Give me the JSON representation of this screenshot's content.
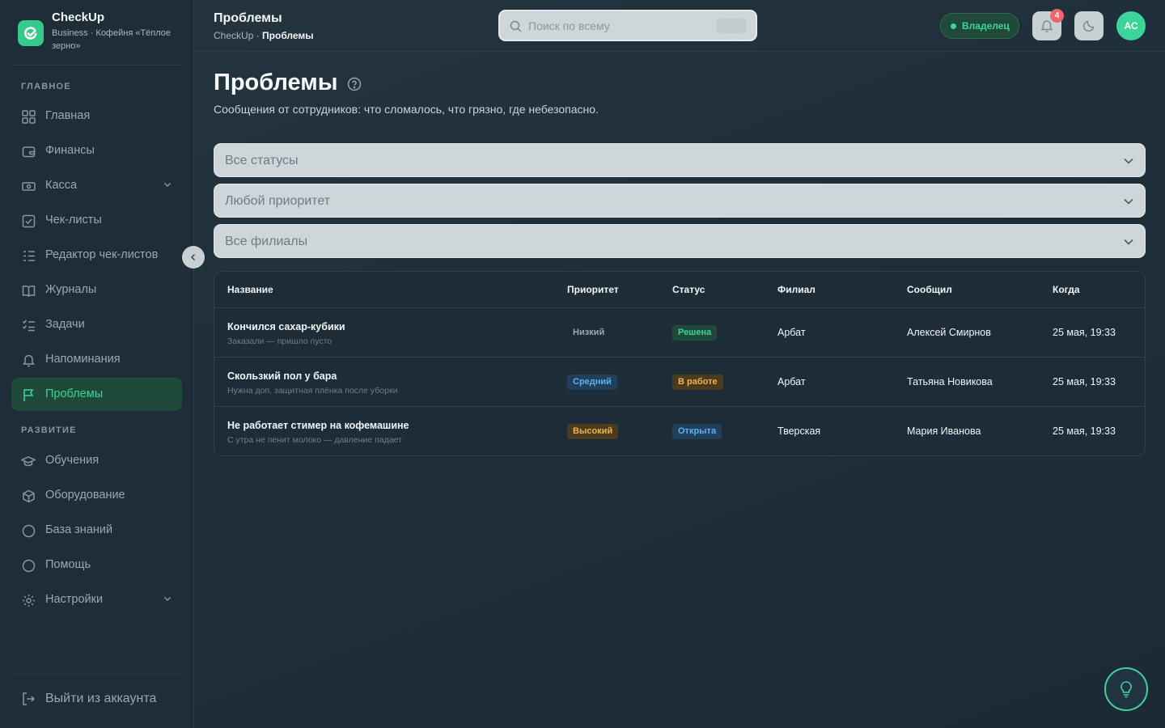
{
  "brand": {
    "name": "CheckUp",
    "subtitle": "Business · Кофейня «Тёплое зерно»"
  },
  "sidebar": {
    "sections": [
      "ГЛАВНОЕ",
      "РАЗВИТИЕ"
    ],
    "items": [
      {
        "label": "Главная",
        "icon": "grid-icon"
      },
      {
        "label": "Финансы",
        "icon": "wallet-icon"
      },
      {
        "label": "Касса",
        "icon": "cash-icon"
      },
      {
        "label": "Чек-листы",
        "icon": "checkbox-icon"
      },
      {
        "label": "Редактор чек-листов",
        "icon": "list-edit-icon"
      },
      {
        "label": "Журналы",
        "icon": "book-icon"
      },
      {
        "label": "Задачи",
        "icon": "tasks-icon"
      },
      {
        "label": "Напоминания",
        "icon": "bell-icon"
      },
      {
        "label": "Проблемы",
        "icon": "flag-icon"
      },
      {
        "label": "Обучения",
        "icon": "graduation-icon"
      },
      {
        "label": "Оборудование",
        "icon": "box-icon"
      },
      {
        "label": "База знаний",
        "icon": "circle-icon"
      },
      {
        "label": "Помощь",
        "icon": "circle-icon"
      },
      {
        "label": "Настройки",
        "icon": "gear-icon"
      }
    ],
    "logout": "Выйти из аккаунта"
  },
  "header": {
    "title": "Проблемы",
    "breadcrumb_root": "CheckUp",
    "breadcrumb_sep": " · ",
    "breadcrumb_current": "Проблемы",
    "search_placeholder": "Поиск по всему",
    "role": "Владелец",
    "notifications": "4",
    "avatar": "АС"
  },
  "page": {
    "title": "Проблемы",
    "subtitle": "Сообщения от сотрудников: что сломалось, что грязно, где небезопасно."
  },
  "filters": {
    "status": "Все статусы",
    "priority": "Любой приоритет",
    "branch": "Все филиалы"
  },
  "table": {
    "headers": [
      "Название",
      "Приоритет",
      "Статус",
      "Филиал",
      "Сообщил",
      "Когда"
    ],
    "rows": [
      {
        "title": "Кончился сахар-кубики",
        "desc": "Заказали — пришло пусто",
        "priority": "Низкий",
        "status": "Решена",
        "branch": "Арбат",
        "reporter": "Алексей Смирнов",
        "when": "25 мая, 19:33"
      },
      {
        "title": "Скользкий пол у бара",
        "desc": "Нужна доп. защитная плёнка после уборки",
        "priority": "Средний",
        "status": "В работе",
        "branch": "Арбат",
        "reporter": "Татьяна Новикова",
        "when": "25 мая, 19:33"
      },
      {
        "title": "Не работает стимер на кофемашине",
        "desc": "С утра не пенит молоко — давление падает",
        "priority": "Высокий",
        "status": "Открыта",
        "branch": "Тверская",
        "reporter": "Мария Иванова",
        "when": "25 мая, 19:33"
      }
    ]
  },
  "colors": {
    "accent": "#3ed39a",
    "active_bg": "#1f4a3a"
  }
}
